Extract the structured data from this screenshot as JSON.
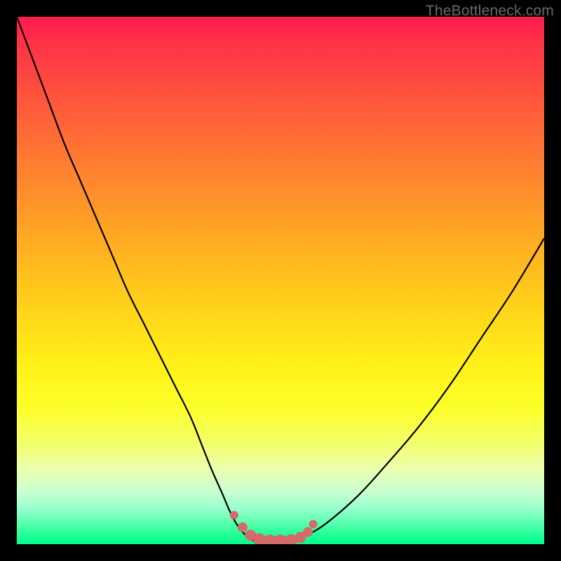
{
  "watermark": "TheBottleneck.com",
  "colors": {
    "frame": "#000000",
    "curve": "#000000",
    "marker_fill": "#d46a6a",
    "marker_stroke": "#d46a6a"
  },
  "chart_data": {
    "type": "line",
    "title": "",
    "xlabel": "",
    "ylabel": "",
    "xlim": [
      0,
      100
    ],
    "ylim": [
      0,
      100
    ],
    "grid": false,
    "legend": false,
    "series": [
      {
        "name": "bottleneck-curve",
        "x": [
          0,
          3,
          6,
          9,
          12,
          15,
          18,
          21,
          24,
          27,
          30,
          33,
          35,
          37,
          39,
          40.5,
          42,
          43.5,
          45,
          47,
          49,
          52,
          56,
          60,
          65,
          70,
          76,
          82,
          88,
          94,
          100
        ],
        "y": [
          100,
          92,
          84,
          76,
          69,
          62,
          55,
          48,
          42,
          36,
          30,
          24,
          19,
          14,
          9.5,
          6,
          3.3,
          1.6,
          0.6,
          0.1,
          0.1,
          0.6,
          2.2,
          5,
          9.5,
          15,
          22,
          30,
          39,
          48,
          58
        ]
      }
    ],
    "annotations": {
      "optimal_range": {
        "x_start": 41,
        "x_end": 56,
        "description": "Flat bottom of curve highlighted with pink markers"
      }
    },
    "markers": {
      "name": "optimal-dots",
      "x": [
        41.2,
        42.8,
        44.3,
        46.0,
        48.0,
        50.0,
        52.0,
        53.8,
        55.2,
        56.2
      ],
      "y": [
        5.5,
        3.2,
        1.7,
        0.9,
        0.5,
        0.5,
        0.7,
        1.3,
        2.3,
        3.8
      ]
    }
  }
}
